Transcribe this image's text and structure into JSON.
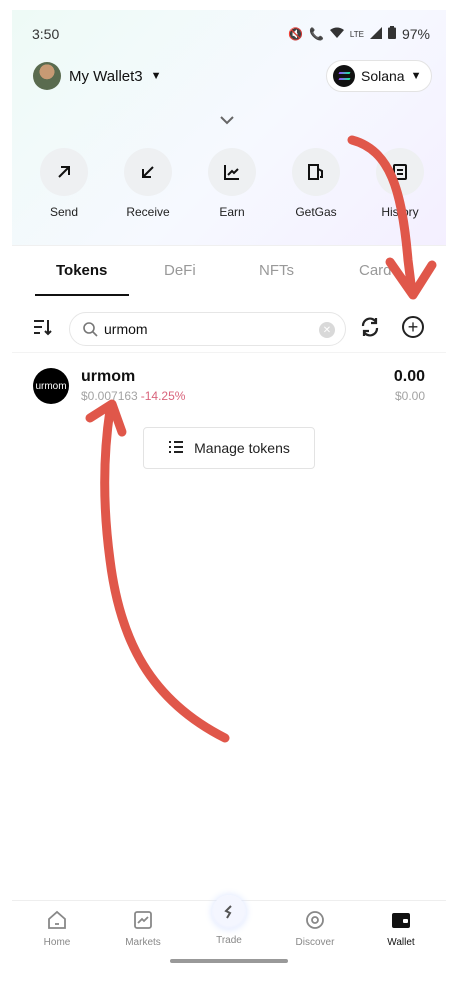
{
  "status_bar": {
    "time": "3:50",
    "network": "LTE",
    "battery": "97%"
  },
  "header": {
    "wallet_name": "My Wallet3",
    "chain": "Solana"
  },
  "actions": [
    {
      "label": "Send",
      "icon": "arrow-up-right-icon"
    },
    {
      "label": "Receive",
      "icon": "arrow-down-left-icon"
    },
    {
      "label": "Earn",
      "icon": "chart-line-icon"
    },
    {
      "label": "GetGas",
      "icon": "gas-pump-icon"
    },
    {
      "label": "History",
      "icon": "history-icon"
    }
  ],
  "tabs": [
    {
      "label": "Tokens",
      "active": true
    },
    {
      "label": "DeFi",
      "active": false
    },
    {
      "label": "NFTs",
      "active": false
    },
    {
      "label": "Card",
      "active": false
    }
  ],
  "search": {
    "value": "urmom"
  },
  "tokens": [
    {
      "logo_text": "urmom",
      "name": "urmom",
      "price": "$0.007163",
      "change": "-14.25%",
      "balance": "0.00",
      "value": "$0.00"
    }
  ],
  "manage_tokens_label": "Manage tokens",
  "bottom_nav": [
    {
      "label": "Home",
      "icon": "home-icon",
      "active": false
    },
    {
      "label": "Markets",
      "icon": "markets-icon",
      "active": false
    },
    {
      "label": "Trade",
      "icon": "trade-icon",
      "active": false
    },
    {
      "label": "Discover",
      "icon": "discover-icon",
      "active": false
    },
    {
      "label": "Wallet",
      "icon": "wallet-icon",
      "active": true
    }
  ],
  "colors": {
    "accent": "#111111",
    "negative": "#d9647c",
    "annotation": "#e0574a"
  }
}
